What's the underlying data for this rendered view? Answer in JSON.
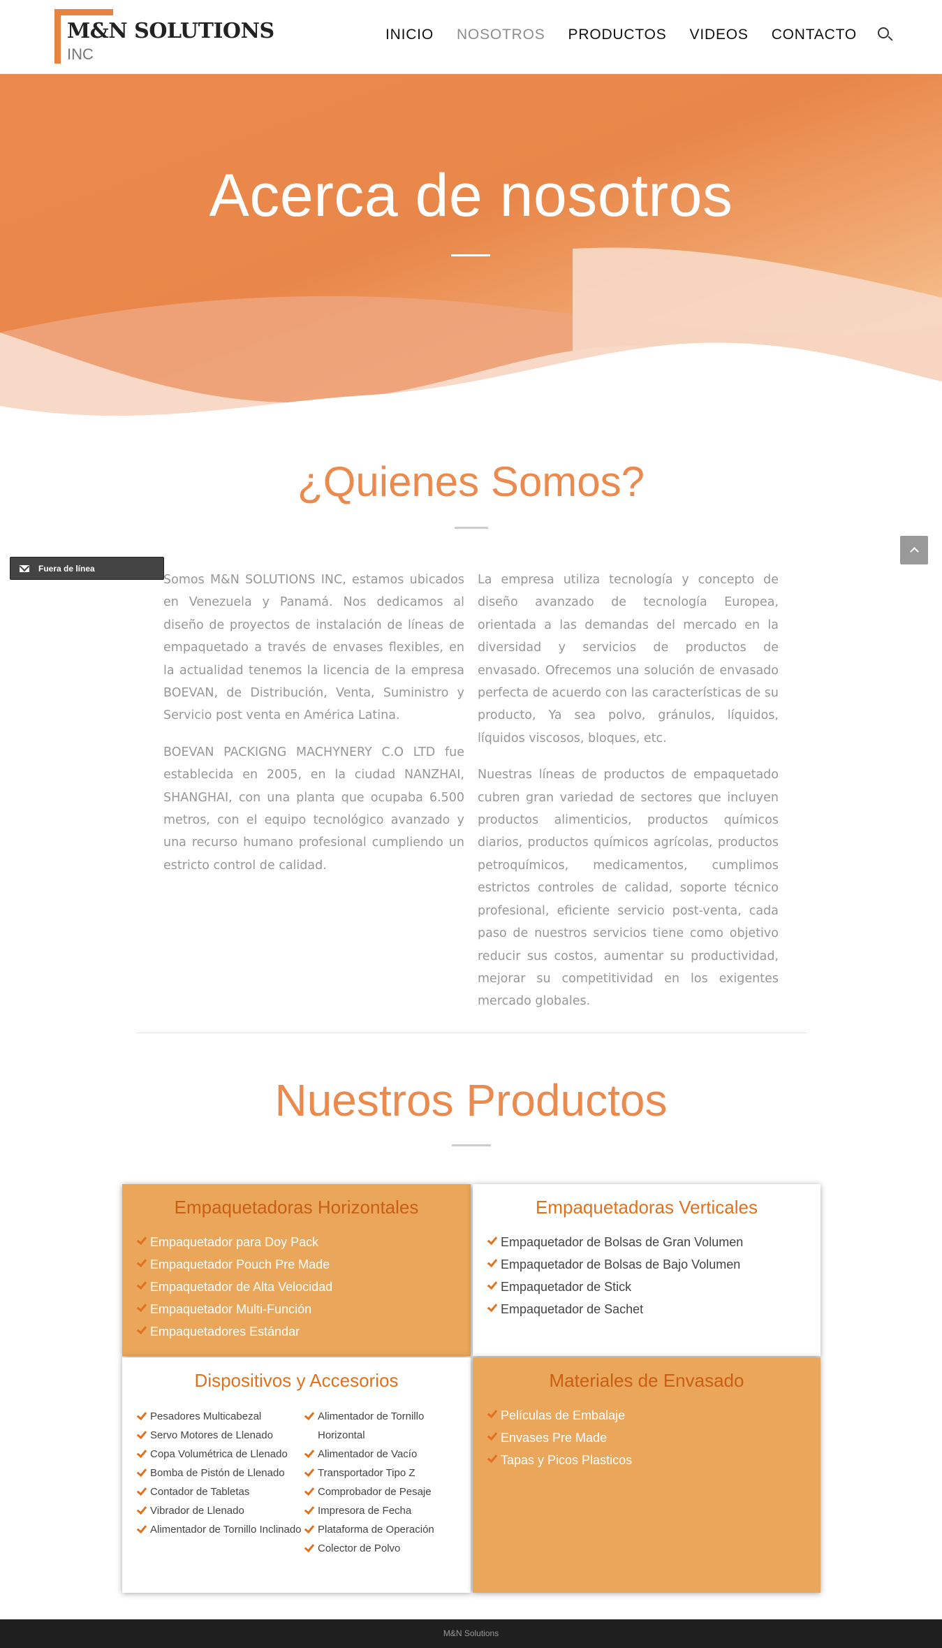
{
  "header": {
    "logo_name": "M&N SOLUTIONS",
    "logo_suffix": "INC",
    "nav": [
      {
        "label": "INICIO"
      },
      {
        "label": "NOSOTROS"
      },
      {
        "label": "PRODUCTOS"
      },
      {
        "label": "VIDEOS"
      },
      {
        "label": "CONTACTO"
      }
    ],
    "search_icon": "search-icon"
  },
  "hero": {
    "title": "Acerca de nosotros"
  },
  "about": {
    "title": "¿Quienes Somos?",
    "left": [
      "Somos M&N SOLUTIONS INC,  estamos ubicados en Venezuela y Panamá. Nos dedicamos al diseño de proyectos de instalación de líneas de empaquetado a través de envases flexibles, en la actualidad tenemos la licencia de la empresa BOEVAN, de Distribución, Venta, Suministro y Servicio post venta en América Latina.",
      "BOEVAN PACKIGNG MACHYNERY C.O LTD fue establecida en 2005, en la ciudad NANZHAI, SHANGHAI, con una planta que ocupaba 6.500 metros, con el equipo tecnológico avanzado y una recurso humano profesional cumpliendo un estricto control de calidad."
    ],
    "right": [
      "La empresa utiliza tecnología y concepto de diseño avanzado de  tecnología Europea, orientada a las demandas del mercado en la diversidad y servicios de productos de envasado. Ofrecemos una solución de envasado perfecta de acuerdo con las características de su producto, Ya sea polvo, gránulos, líquidos, líquidos viscosos, bloques, etc.",
      "Nuestras  líneas de productos de empaquetado cubren gran variedad de sectores que incluyen productos alimenticios, productos químicos diarios, productos químicos agrícolas, productos petroquímicos, medicamentos, cumplimos estrictos controles de calidad, soporte técnico profesional, eficiente servicio post-venta, cada paso de nuestros servicios tiene como objetivo reducir sus costos, aumentar su productividad, mejorar su competitividad en los exigentes mercado globales."
    ]
  },
  "chat": {
    "label": "Fuera de línea"
  },
  "products": {
    "title": "Nuestros Productos",
    "horizontal": {
      "title": "Empaquetadoras Horizontales",
      "items": [
        "Empaquetador para Doy Pack",
        "Empaquetador Pouch Pre Made",
        "Empaquetador de Alta Velocidad",
        "Empaquetador Multi-Función",
        "Empaquetadores Estándar"
      ]
    },
    "vertical": {
      "title": "Empaquetadoras Verticales",
      "items": [
        "Empaquetador de Bolsas de Gran Volumen",
        "Empaquetador de Bolsas de Bajo Volumen",
        "Empaquetador de Stick",
        "Empaquetador de Sachet"
      ]
    },
    "devices": {
      "title": "Dispositivos y Accesorios",
      "col_a": [
        "Pesadores Multicabezal",
        "Servo Motores de Llenado",
        "Copa Volumétrica de Llenado",
        "Bomba de Pistón de Llenado",
        "Contador de Tabletas",
        "Vibrador de Llenado",
        "Alimentador de Tornillo Inclinado"
      ],
      "col_b": [
        "Alimentador de Tornillo Horizontal",
        "Alimentador de Vacío",
        "Transportador Tipo Z",
        "Comprobador de Pesaje",
        "Impresora de Fecha",
        "Plataforma de Operación",
        "Colector de Polvo"
      ]
    },
    "materials": {
      "title": "Materiales de Envasado",
      "items": [
        "Películas de Embalaje",
        "Envases Pre Made",
        "Tapas y Picos Plasticos"
      ]
    }
  },
  "footer": {
    "text": "M&N Solutions"
  },
  "colors": {
    "accent": "#ec8a4e",
    "card_orange": "#eaa65b",
    "footer": "#1f1f1f"
  }
}
